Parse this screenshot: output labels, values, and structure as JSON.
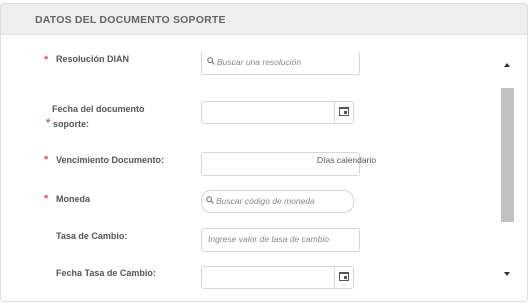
{
  "section": {
    "title": "DATOS DEL DOCUMENTO SOPORTE"
  },
  "fields": {
    "resolucion": {
      "required_mark": "*",
      "label": "Resolución DIAN",
      "placeholder": "Buscar una resolución"
    },
    "fecha_doc": {
      "required_mark": "*",
      "label_line1": "Fecha del documento",
      "label_line2": "soporte:",
      "value": ""
    },
    "vencimiento": {
      "required_mark": "*",
      "label": "Vencimiento Documento:",
      "suffix": "Días calendario",
      "value": ""
    },
    "moneda": {
      "required_mark": "*",
      "label": "Moneda",
      "placeholder": "Buscar código de moneda"
    },
    "tasa_cambio": {
      "label": "Tasa de Cambio:",
      "placeholder": "Ingrese valor de tasa de cambio"
    },
    "fecha_tasa": {
      "label": "Fecha Tasa de Cambio:",
      "value": ""
    }
  },
  "icons": {
    "search": "search-icon",
    "calendar": "calendar-icon"
  }
}
